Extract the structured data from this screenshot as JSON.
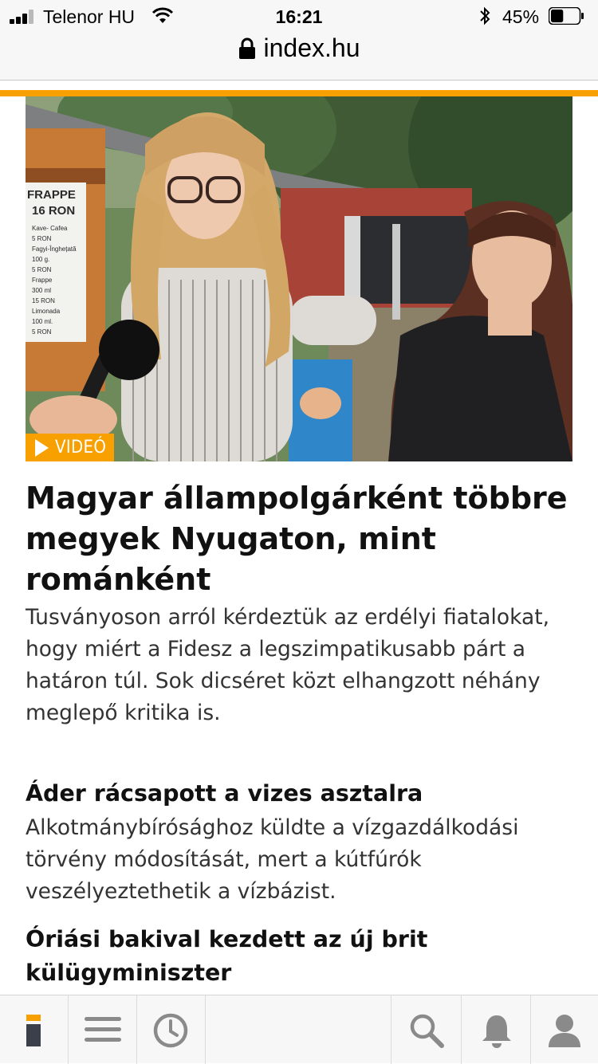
{
  "status_bar": {
    "carrier": "Telenor HU",
    "time": "16:21",
    "battery_percent": "45%",
    "battery_level": 0.45,
    "signal_bars": 3
  },
  "browser": {
    "url": "index.hu"
  },
  "colors": {
    "accent": "#f7a000",
    "nav_icon": "#8a8a8a"
  },
  "hero": {
    "badge_label": "VIDEÓ",
    "badge_icon": "play-icon",
    "sign_lines": [
      "FRAPPE",
      "16 RON",
      "Kave- Cafea",
      "5 RON",
      "Fagyi-Înghețată",
      "100 g.",
      "5 RON",
      "Frappe",
      "300 ml",
      "15 RON",
      "Limonada",
      "100 ml.",
      "5 RON"
    ]
  },
  "articles": [
    {
      "title": "Magyar állampolgárként többre megyek Nyugaton, mint románként",
      "lead": "Tusványoson arról kérdeztük az erdélyi fiatalokat, hogy miért a Fidesz a legszimpatikusabb párt a határon túl. Sok dicséret közt elhangzott néhány meglepő kritika is."
    },
    {
      "title": "Áder rácsapott a vizes asztalra",
      "lead": "Alkotmánybírósághoz küldte a vízgazdálkodási törvény módosítását, mert a kútfúrók veszélyeztethetik a vízbázist."
    },
    {
      "title": "Óriási bakival kezdett az új brit külügyminiszter"
    }
  ],
  "bottom_nav": {
    "items": [
      "index-logo-icon",
      "menu-icon",
      "clock-icon",
      "search-icon",
      "bell-icon",
      "user-icon"
    ]
  }
}
